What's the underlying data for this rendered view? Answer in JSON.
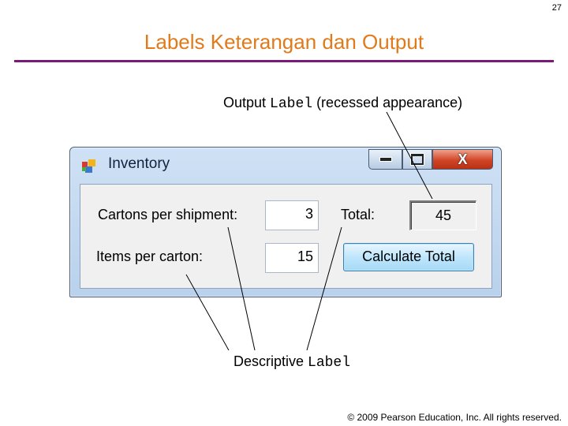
{
  "page_number": "27",
  "slide_title": "Labels Keterangan dan Output",
  "callout_output": {
    "prefix": "Output ",
    "code": "Label",
    "suffix": " (recessed appearance)"
  },
  "callout_descriptive": {
    "prefix": "Descriptive ",
    "code": "Label"
  },
  "copyright": "© 2009 Pearson Education, Inc. All rights reserved.",
  "colors": {
    "title": "#e07a1a",
    "rule": "#7a1b7a",
    "close_button": "#d14526"
  },
  "window": {
    "title": "Inventory",
    "icon": "app-form-icon",
    "controls": {
      "minimize_icon": "minimize-icon",
      "maximize_icon": "maximize-icon",
      "close_glyph": "X"
    },
    "labels": {
      "cartons": "Cartons per shipment:",
      "items": "Items per carton:",
      "total": "Total:"
    },
    "inputs": {
      "cartons": "3",
      "items": "15"
    },
    "output_total": "45",
    "calculate_button": "Calculate Total"
  }
}
